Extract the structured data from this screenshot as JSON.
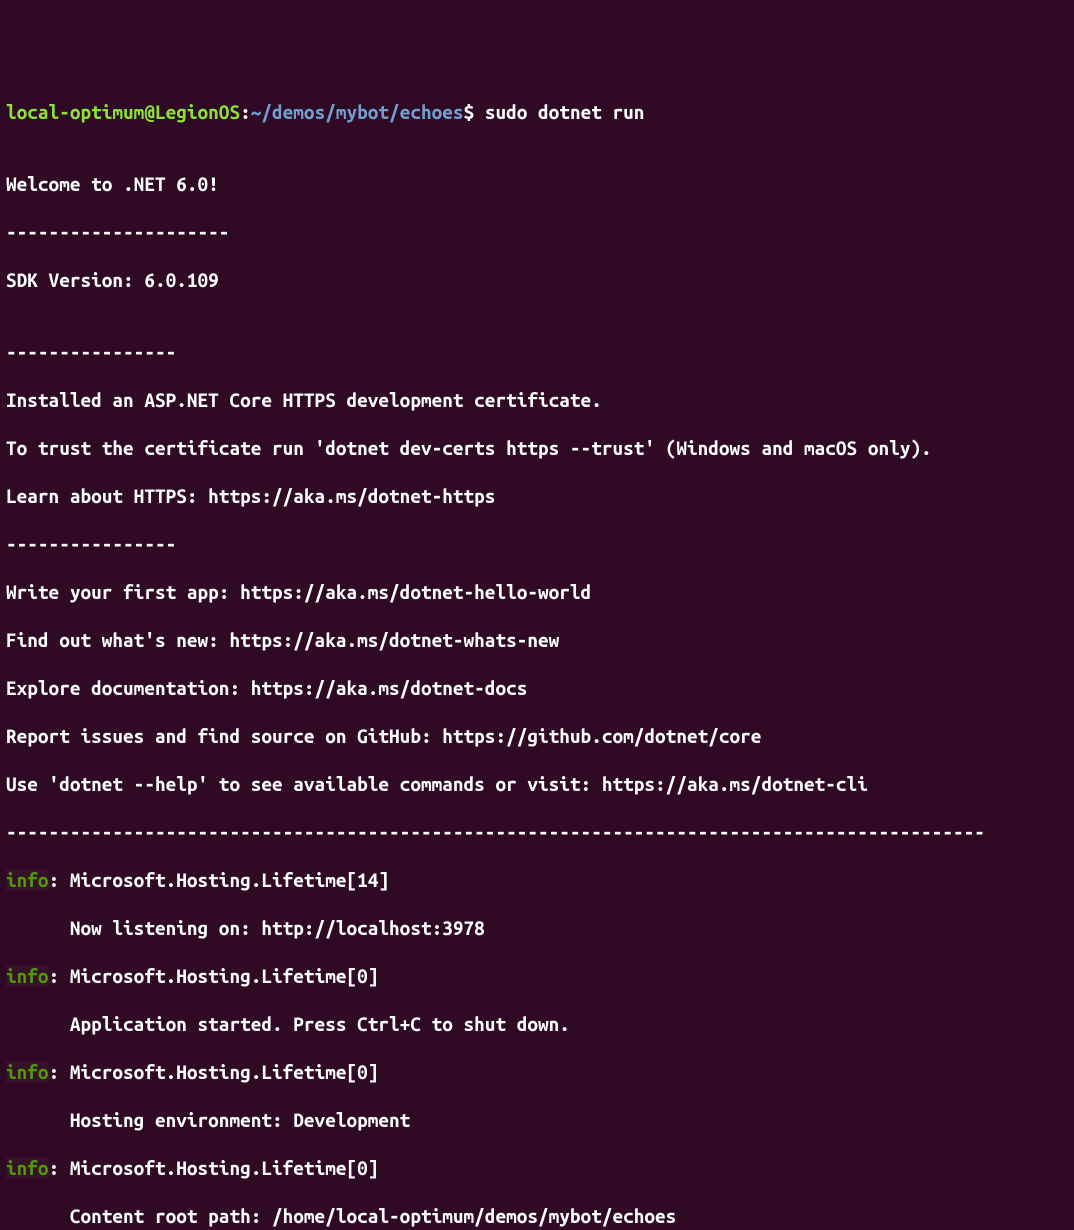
{
  "prompt": {
    "user_host": "local-optimum@LegionOS",
    "colon": ":",
    "cwd": "~/demos/mybot/echoes",
    "dollar": "$ ",
    "command": "sudo dotnet run"
  },
  "lines": {
    "blank": "",
    "welcome": "Welcome to .NET 6.0!",
    "dash1": "---------------------",
    "sdk": "SDK Version: 6.0.109",
    "dash2": "----------------",
    "cert1": "Installed an ASP.NET Core HTTPS development certificate.",
    "cert2": "To trust the certificate run 'dotnet dev-certs https --trust' (Windows and macOS only).",
    "cert3": "Learn about HTTPS: https://aka.ms/dotnet-https",
    "dash3": "----------------",
    "app1": "Write your first app: https://aka.ms/dotnet-hello-world",
    "app2": "Find out what's new: https://aka.ms/dotnet-whats-new",
    "app3": "Explore documentation: https://aka.ms/dotnet-docs",
    "app4": "Report issues and find source on GitHub: https://github.com/dotnet/core",
    "app5": "Use 'dotnet --help' to see available commands or visit: https://aka.ms/dotnet-cli",
    "dashlong": "--------------------------------------------------------------------------------------------"
  },
  "log": [
    {
      "tag": "info",
      "src": ": Microsoft.Hosting.Lifetime[14]",
      "msg": "      Now listening on: http://localhost:3978"
    },
    {
      "tag": "info",
      "src": ": Microsoft.Hosting.Lifetime[0]",
      "msg": "      Application started. Press Ctrl+C to shut down."
    },
    {
      "tag": "info",
      "src": ": Microsoft.Hosting.Lifetime[0]",
      "msg": "      Hosting environment: Development"
    },
    {
      "tag": "info",
      "src": ": Microsoft.Hosting.Lifetime[0]",
      "msg": "      Content root path: /home/local-optimum/demos/mybot/echoes"
    }
  ]
}
